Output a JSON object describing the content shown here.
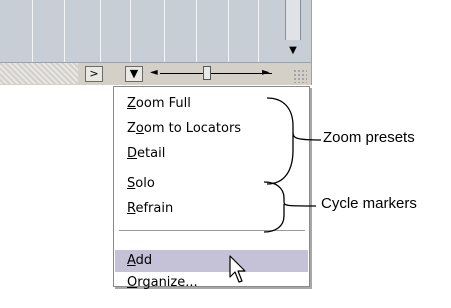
{
  "bottom_bar": {
    "scroll_right_glyph": ">",
    "zoom_menu_glyph": "▼",
    "slider_left_glyph": "◄",
    "slider_right_glyph": "►",
    "scroll_down_glyph": "▼"
  },
  "menu": {
    "zoom_items": [
      {
        "accel": "Z",
        "rest": "oom Full"
      },
      {
        "pre": "Z",
        "accel": "o",
        "rest": "om to Locators"
      },
      {
        "accel": "D",
        "rest": "etail"
      }
    ],
    "cycle_items": [
      {
        "accel": "S",
        "rest": "olo"
      },
      {
        "accel": "R",
        "rest": "efrain"
      }
    ],
    "action_items": [
      {
        "accel": "A",
        "rest": "dd",
        "highlighted": true
      },
      {
        "accel": "O",
        "rest": "rganize..."
      }
    ]
  },
  "callouts": {
    "zoom_presets": "Zoom presets",
    "cycle_markers": "Cycle markers"
  },
  "colors": {
    "highlight": "#c5c1d6",
    "track_bg": "#c8ced6"
  }
}
